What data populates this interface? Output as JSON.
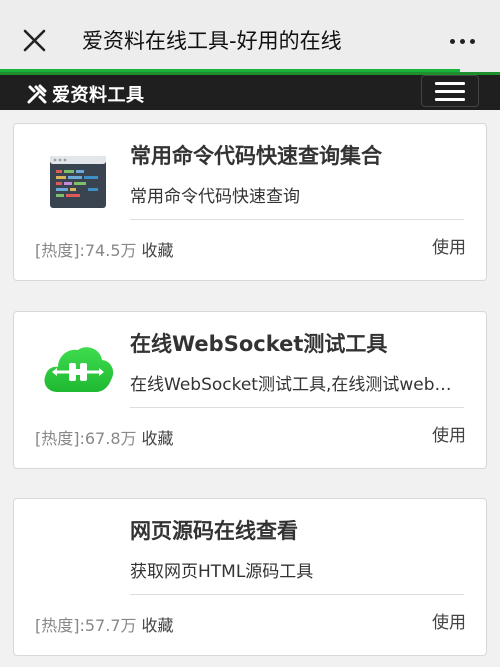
{
  "topbar": {
    "title": "爱资料在线工具-好用的在线",
    "close_icon": "close-icon",
    "more_icon": "more-horizontal-icon"
  },
  "progress": {
    "fraction": 0.92,
    "color": "#19b23b"
  },
  "site_header": {
    "logo_text": "爱资料工具",
    "logo_icon": "tools-icon",
    "menu_icon": "hamburger-menu-icon"
  },
  "cards": [
    {
      "title": "常用命令代码快速查询集合",
      "description": "常用命令代码快速查询",
      "heat_label": "[热度]:74.5万",
      "favorite_label": "收藏",
      "use_label": "使用",
      "icon": "code-window-icon"
    },
    {
      "title": "在线WebSocket测试工具",
      "description": "在线WebSocket测试工具,在线测试websocket连接",
      "heat_label": "[热度]:67.8万",
      "favorite_label": "收藏",
      "use_label": "使用",
      "icon": "cloud-connection-icon"
    },
    {
      "title": "网页源码在线查看",
      "description": "获取网页HTML源码工具",
      "heat_label": "[热度]:57.7万",
      "favorite_label": "收藏",
      "use_label": "使用",
      "icon": ""
    }
  ],
  "colors": {
    "accent_green": "#19b23b",
    "header_bg": "#1f1f1f",
    "page_bg": "#f1f1f1"
  }
}
